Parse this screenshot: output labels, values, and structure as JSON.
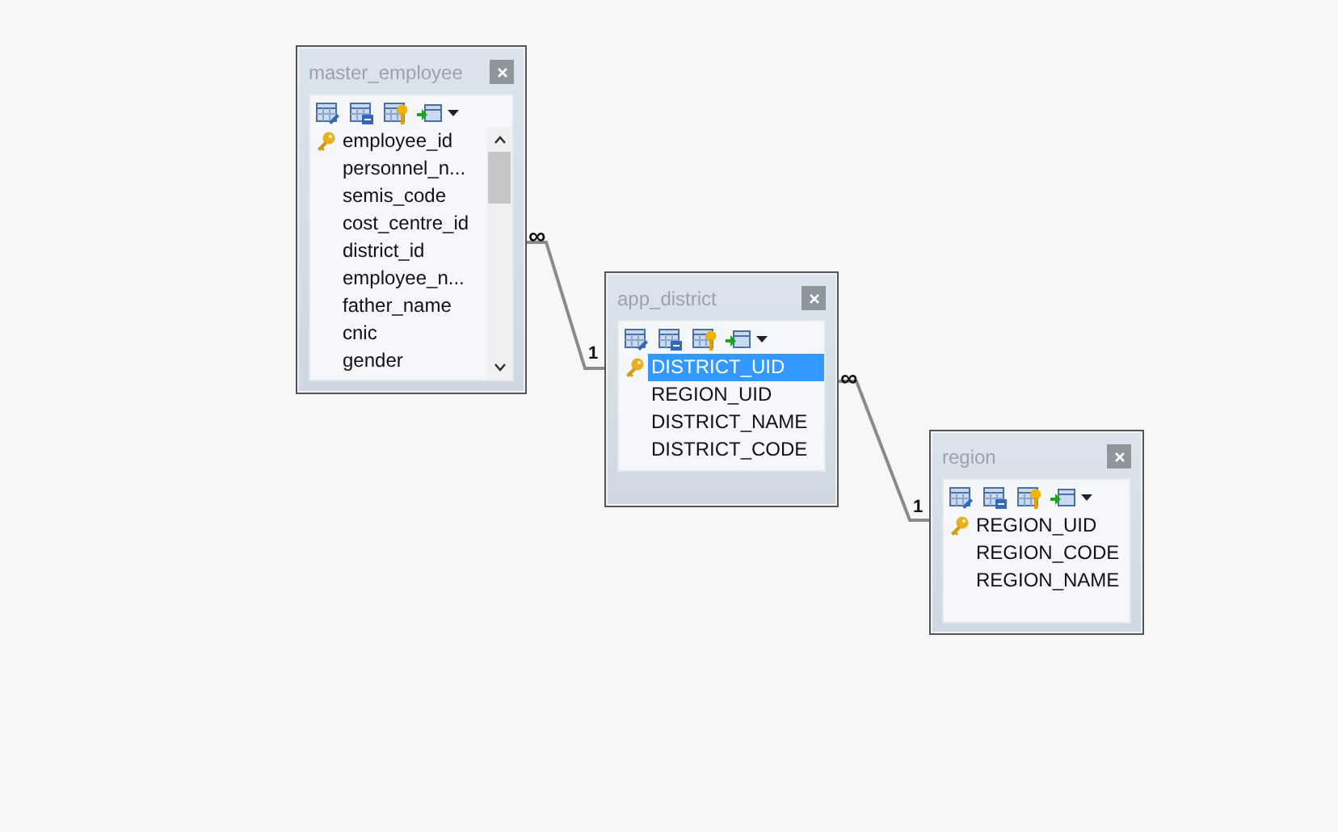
{
  "tables": [
    {
      "title": "master_employee",
      "scrollbar": true,
      "columns": [
        {
          "name": "employee_id",
          "primary_key": true,
          "selected": false
        },
        {
          "name": "personnel_n...",
          "primary_key": false,
          "selected": false
        },
        {
          "name": "semis_code",
          "primary_key": false,
          "selected": false
        },
        {
          "name": "cost_centre_id",
          "primary_key": false,
          "selected": false
        },
        {
          "name": "district_id",
          "primary_key": false,
          "selected": false
        },
        {
          "name": "employee_n...",
          "primary_key": false,
          "selected": false
        },
        {
          "name": "father_name",
          "primary_key": false,
          "selected": false
        },
        {
          "name": "cnic",
          "primary_key": false,
          "selected": false
        },
        {
          "name": "gender",
          "primary_key": false,
          "selected": false
        }
      ]
    },
    {
      "title": "app_district",
      "scrollbar": false,
      "columns": [
        {
          "name": "DISTRICT_UID",
          "primary_key": true,
          "selected": true
        },
        {
          "name": "REGION_UID",
          "primary_key": false,
          "selected": false
        },
        {
          "name": "DISTRICT_NAME",
          "primary_key": false,
          "selected": false
        },
        {
          "name": "DISTRICT_CODE",
          "primary_key": false,
          "selected": false
        }
      ]
    },
    {
      "title": "region",
      "scrollbar": false,
      "columns": [
        {
          "name": "REGION_UID",
          "primary_key": true,
          "selected": false
        },
        {
          "name": "REGION_CODE",
          "primary_key": false,
          "selected": false
        },
        {
          "name": "REGION_NAME",
          "primary_key": false,
          "selected": false
        }
      ]
    }
  ],
  "relations": [
    {
      "many_label": "∞",
      "one_label": "1"
    },
    {
      "many_label": "∞",
      "one_label": "1"
    }
  ]
}
